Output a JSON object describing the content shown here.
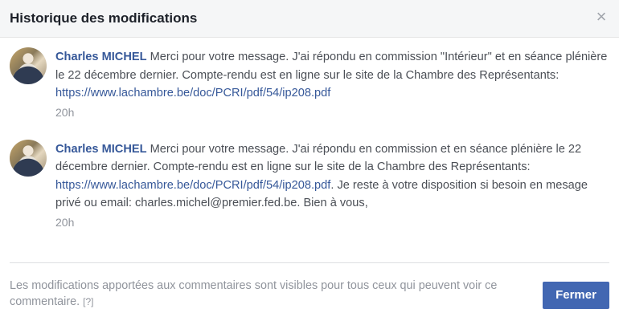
{
  "dialog": {
    "title": "Historique des modifications",
    "close_glyph": "×",
    "close_button_label": "Fermer"
  },
  "comments": [
    {
      "author": "Charles MICHEL",
      "text_before_link": " Merci pour votre message. J'ai répondu en commission \"Intérieur\" et en séance plénière le 22 décembre dernier. Compte-rendu est en ligne sur le site de la Chambre des Représentants: ",
      "link": "https://www.lachambre.be/doc/PCRI/pdf/54/ip208.pdf",
      "text_after_link": "",
      "time": "20h"
    },
    {
      "author": "Charles MICHEL",
      "text_before_link": " Merci pour votre message. J'ai répondu en commission et en séance plénière le 22 décembre dernier. Compte-rendu est en ligne sur le site de la Chambre des Représentants: ",
      "link": "https://www.lachambre.be/doc/PCRI/pdf/54/ip208.pdf",
      "text_after_link": ". Je reste à votre disposition si besoin en mesage privé ou email: charles.michel@premier.fed.be. Bien à vous,",
      "time": "20h"
    }
  ],
  "footer": {
    "note": "Les modifications apportées aux commentaires sont visibles pour tous ceux qui peuvent voir ce commentaire. ",
    "help": "[?]"
  },
  "colors": {
    "link": "#365899",
    "button": "#4267b2"
  }
}
